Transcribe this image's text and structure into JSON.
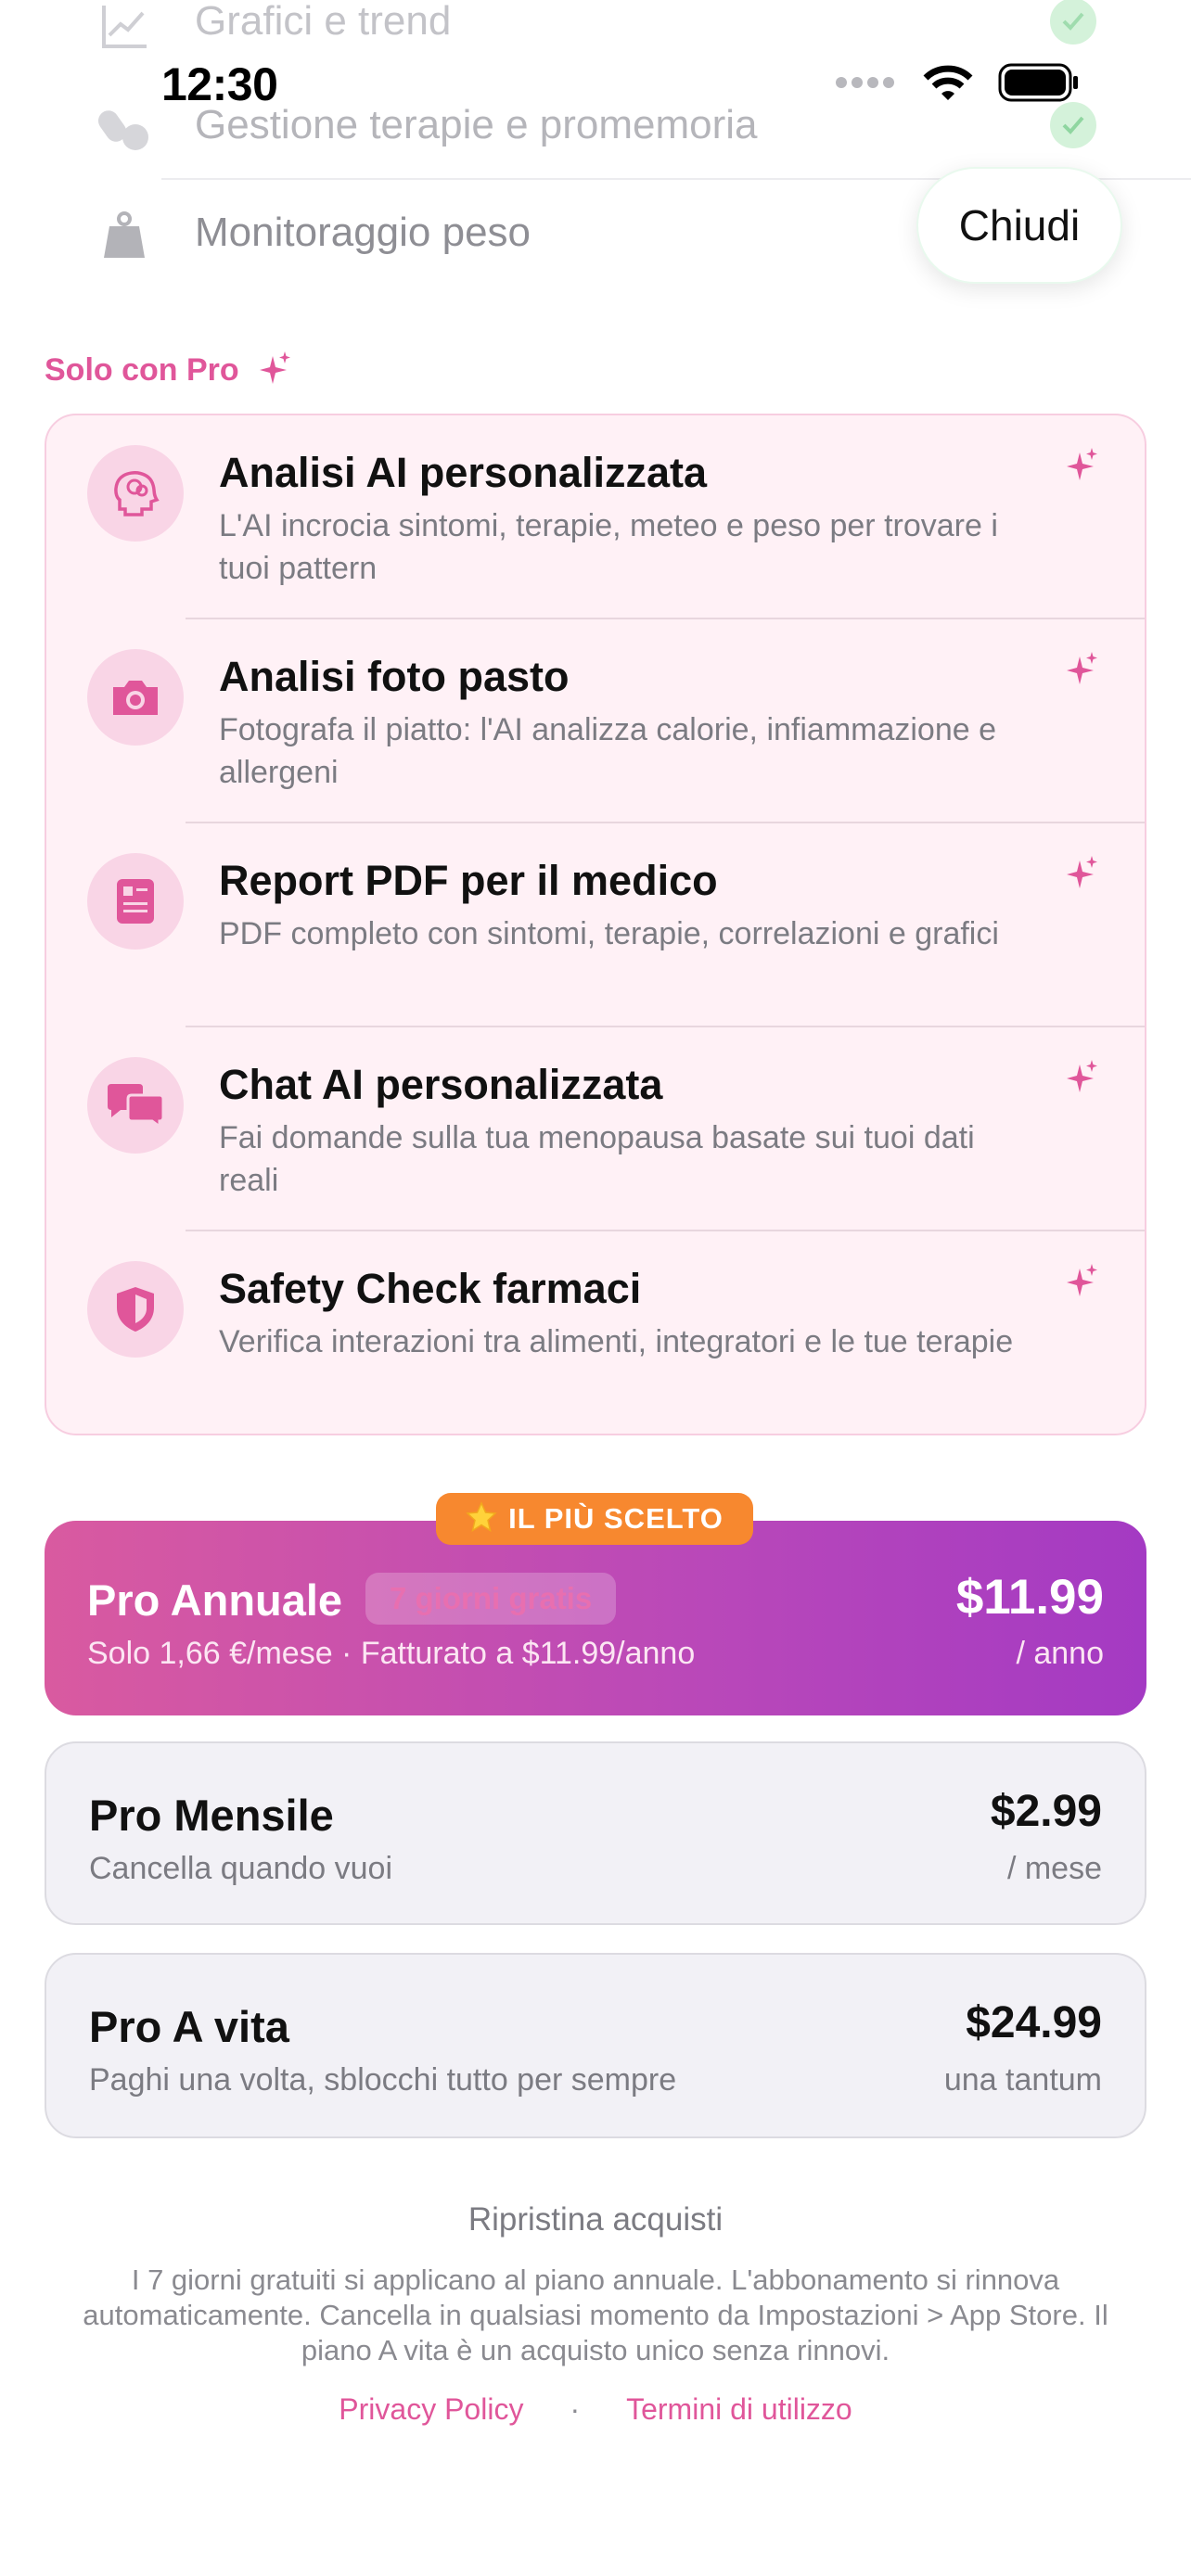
{
  "status_bar": {
    "time": "12:30"
  },
  "free_features": [
    {
      "label": "Grafici e trend",
      "icon": "chart-icon"
    },
    {
      "label": "Gestione terapie e promemoria",
      "icon": "pills-icon"
    },
    {
      "label": "Monitoraggio peso",
      "icon": "scale-icon"
    }
  ],
  "close_label": "Chiudi",
  "pro_section": {
    "title": "Solo con Pro",
    "features": [
      {
        "title": "Analisi AI personalizzata",
        "desc": "L'AI incrocia sintomi, terapie, meteo e peso per trovare i tuoi pattern",
        "icon": "brain-icon"
      },
      {
        "title": "Analisi foto pasto",
        "desc": "Fotografa il piatto: l'AI analizza calorie, infiammazione e allergeni",
        "icon": "camera-icon"
      },
      {
        "title": "Report PDF per il medico",
        "desc": "PDF completo con sintomi, terapie, correlazioni e grafici",
        "icon": "document-icon"
      },
      {
        "title": "Chat AI personalizzata",
        "desc": "Fai domande sulla tua menopausa basate sui tuoi dati reali",
        "icon": "chat-bubbles-icon"
      },
      {
        "title": "Safety Check farmaci",
        "desc": "Verifica interazioni tra alimenti, integratori e le tue terapie",
        "icon": "shield-icon"
      }
    ]
  },
  "plans": {
    "badge": "IL PIÙ SCELTO",
    "annual": {
      "name": "Pro Annuale",
      "trial": "7 giorni gratis",
      "sub": "Solo 1,66 €/mese · Fatturato a $11.99/anno",
      "price": "$11.99",
      "period": "/ anno"
    },
    "monthly": {
      "name": "Pro Mensile",
      "sub": "Cancella quando vuoi",
      "price": "$2.99",
      "period": "/ mese"
    },
    "lifetime": {
      "name": "Pro A vita",
      "sub": "Paghi una volta, sblocchi tutto per sempre",
      "price": "$24.99",
      "period": "una tantum"
    }
  },
  "footer": {
    "restore": "Ripristina acquisti",
    "legal": "I 7 giorni gratuiti si applicano al piano annuale. L'abbonamento si rinnova automaticamente. Cancella in qualsiasi momento da Impostazioni > App Store. Il piano A vita è un acquisto unico senza rinnovi.",
    "privacy": "Privacy Policy",
    "separator": "·",
    "terms": "Termini di utilizzo"
  },
  "colors": {
    "accent": "#e0569a",
    "badge": "#f7882f",
    "annual_gradient_start": "#d95aa0",
    "annual_gradient_end": "#a43ac3",
    "check": "#d4f2da"
  }
}
